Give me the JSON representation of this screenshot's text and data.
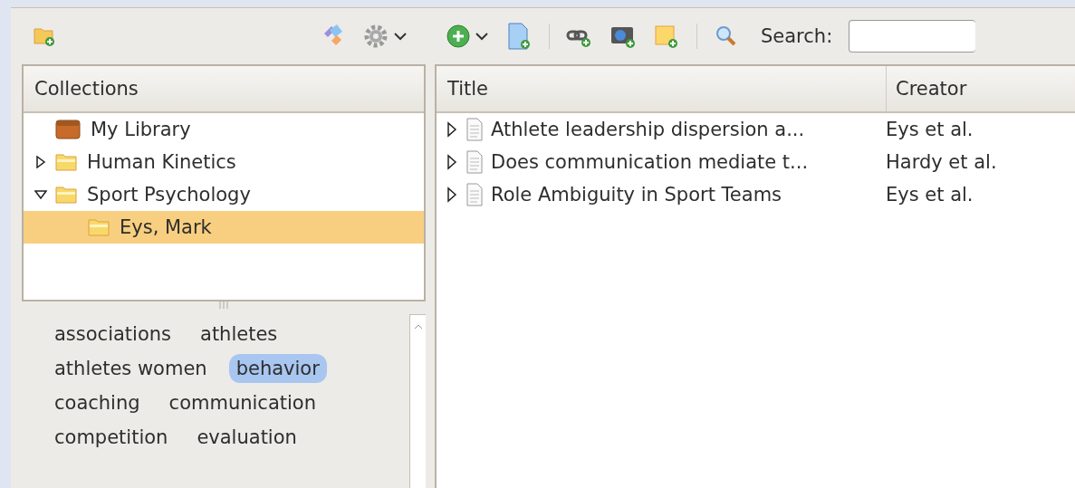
{
  "collections": {
    "header": "Collections",
    "items": [
      {
        "label": "My Library",
        "kind": "library",
        "selected": false
      },
      {
        "label": "Human Kinetics",
        "kind": "folder",
        "selected": false,
        "expanded": false
      },
      {
        "label": "Sport Psychology",
        "kind": "folder",
        "selected": false,
        "expanded": true,
        "children": [
          {
            "label": "Eys, Mark",
            "kind": "folder",
            "selected": true
          }
        ]
      }
    ]
  },
  "tags": [
    {
      "label": "associations",
      "selected": false
    },
    {
      "label": "athletes",
      "selected": false
    },
    {
      "label": "athletes women",
      "selected": false
    },
    {
      "label": "behavior",
      "selected": true
    },
    {
      "label": "coaching",
      "selected": false
    },
    {
      "label": "communication",
      "selected": false
    },
    {
      "label": "competition",
      "selected": false
    },
    {
      "label": "evaluation",
      "selected": false
    }
  ],
  "search": {
    "label": "Search:"
  },
  "table": {
    "columns": [
      "Title",
      "Creator"
    ],
    "rows": [
      {
        "title": "Athlete leadership dispersion a...",
        "creator": "Eys et al.",
        "expanded": false
      },
      {
        "title": "Does communication mediate t...",
        "creator": "Hardy et al.",
        "expanded": false
      },
      {
        "title": "Role Ambiguity in Sport Teams",
        "creator": "Eys et al.",
        "expanded": false
      }
    ]
  }
}
